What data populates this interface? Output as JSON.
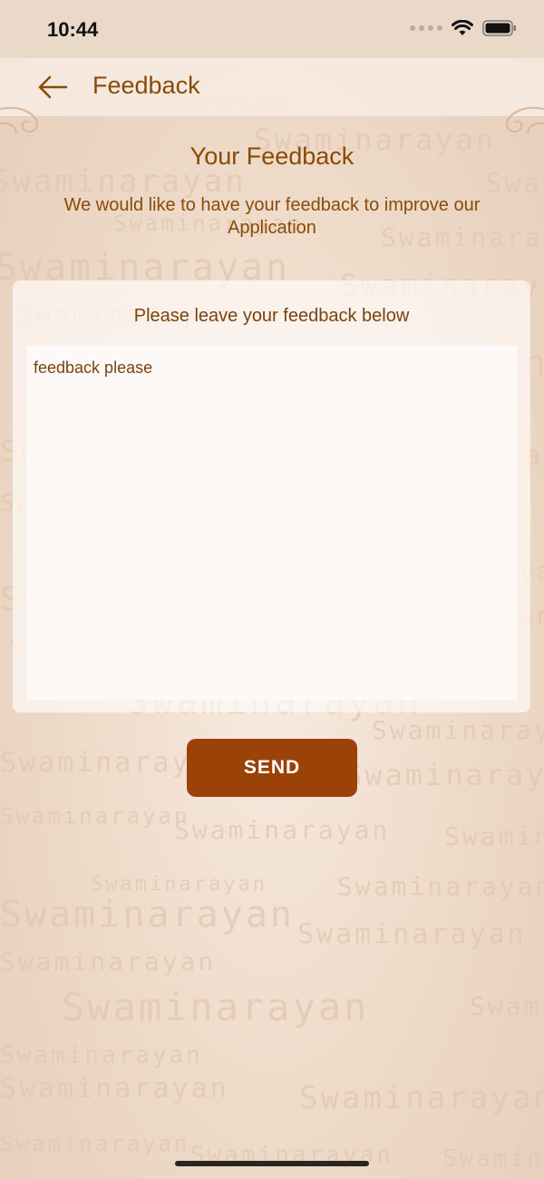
{
  "status_bar": {
    "time": "10:44"
  },
  "nav": {
    "title": "Feedback"
  },
  "content": {
    "heading": "Your Feedback",
    "subtitle": "We would like to have your feedback to improve our Application"
  },
  "form": {
    "prompt": "Please leave your feedback below",
    "feedback_value": "feedback please",
    "send_label": "SEND"
  },
  "background": {
    "watermark_text": "Swaminarayan"
  },
  "colors": {
    "accent": "#8a4a06",
    "button": "#9a4208",
    "background": "#efdccb",
    "card": "#fcf9f7"
  },
  "icons": {
    "back": "arrow-left-icon",
    "signal": "cellular-dots-icon",
    "wifi": "wifi-icon",
    "battery": "battery-icon"
  }
}
